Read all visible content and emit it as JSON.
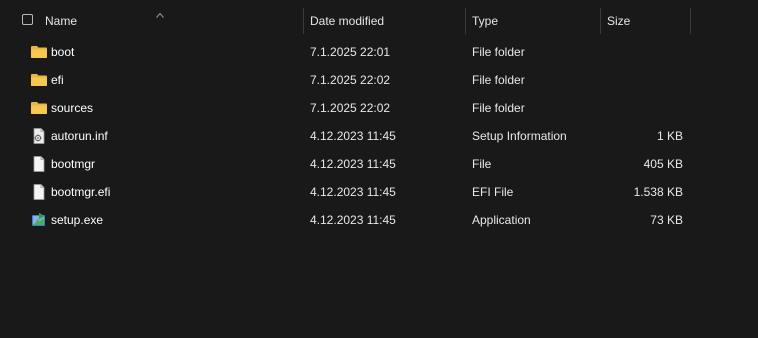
{
  "columns": {
    "name": "Name",
    "date": "Date modified",
    "type": "Type",
    "size": "Size"
  },
  "files": [
    {
      "name": "boot",
      "date": "7.1.2025 22:01",
      "type": "File folder",
      "size": "",
      "icon": "folder-icon"
    },
    {
      "name": "efi",
      "date": "7.1.2025 22:02",
      "type": "File folder",
      "size": "",
      "icon": "folder-icon"
    },
    {
      "name": "sources",
      "date": "7.1.2025 22:02",
      "type": "File folder",
      "size": "",
      "icon": "folder-icon"
    },
    {
      "name": "autorun.inf",
      "date": "4.12.2023 11:45",
      "type": "Setup Information",
      "size": "1 KB",
      "icon": "setup-info-file-icon"
    },
    {
      "name": "bootmgr",
      "date": "4.12.2023 11:45",
      "type": "File",
      "size": "405 KB",
      "icon": "file-icon"
    },
    {
      "name": "bootmgr.efi",
      "date": "4.12.2023 11:45",
      "type": "EFI File",
      "size": "1.538 KB",
      "icon": "file-icon"
    },
    {
      "name": "setup.exe",
      "date": "4.12.2023 11:45",
      "type": "Application",
      "size": "73 KB",
      "icon": "setup-application-icon"
    }
  ],
  "colors": {
    "background": "#191919",
    "folder": "#f4c542",
    "text": "#ffffff"
  }
}
